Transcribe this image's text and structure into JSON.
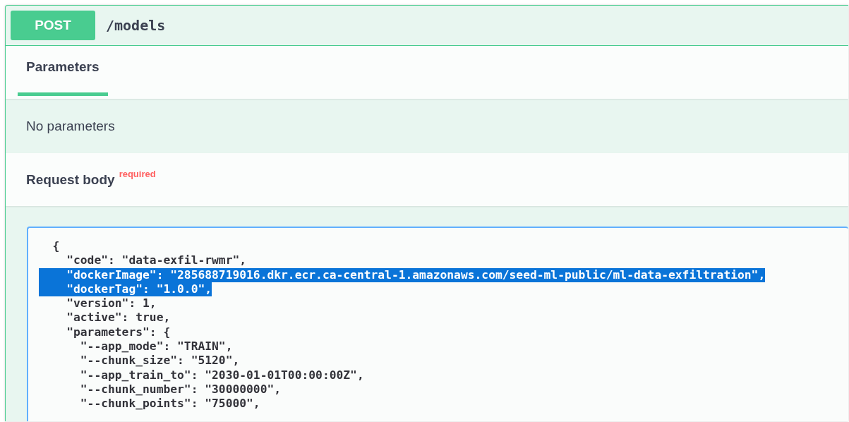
{
  "operation": {
    "method": "POST",
    "path": "/models"
  },
  "tabs": [
    {
      "label": "Parameters",
      "selected": true
    }
  ],
  "parameters": {
    "message": "No parameters"
  },
  "request_body": {
    "title": "Request body",
    "required_label": "required",
    "code_lines": [
      {
        "text": "{",
        "selected": false
      },
      {
        "text": "  \"code\": \"data-exfil-rwmr\",",
        "selected": false
      },
      {
        "text": "  \"dockerImage\": \"285688719016.dkr.ecr.ca-central-1.amazonaws.com/seed-ml-public/ml-data-exfiltration\",",
        "selected": true
      },
      {
        "text": "  \"dockerTag\": \"1.0.0\",",
        "selected": true
      },
      {
        "text": "  \"version\": 1,",
        "selected": false
      },
      {
        "text": "  \"active\": true,",
        "selected": false
      },
      {
        "text": "  \"parameters\": {",
        "selected": false
      },
      {
        "text": "    \"--app_mode\": \"TRAIN\",",
        "selected": false
      },
      {
        "text": "    \"--chunk_size\": \"5120\",",
        "selected": false
      },
      {
        "text": "    \"--app_train_to\": \"2030-01-01T00:00:00Z\",",
        "selected": false
      },
      {
        "text": "    \"--chunk_number\": \"30000000\",",
        "selected": false
      },
      {
        "text": "    \"--chunk_points\": \"75000\",",
        "selected": false
      }
    ]
  }
}
